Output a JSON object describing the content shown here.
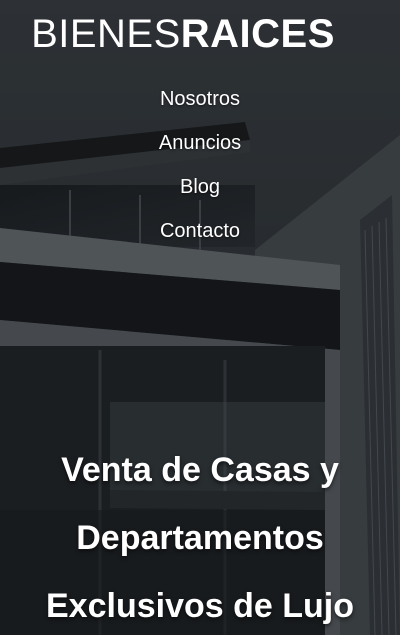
{
  "logo": {
    "light": "BIENES",
    "bold": "RAICES"
  },
  "nav": {
    "items": [
      {
        "label": "Nosotros"
      },
      {
        "label": "Anuncios"
      },
      {
        "label": "Blog"
      },
      {
        "label": "Contacto"
      }
    ]
  },
  "hero": {
    "lines": [
      "Venta de Casas y",
      "Departamentos",
      "Exclusivos de Lujo"
    ]
  },
  "colors": {
    "text": "#ffffff",
    "background": "#2b2f33"
  }
}
